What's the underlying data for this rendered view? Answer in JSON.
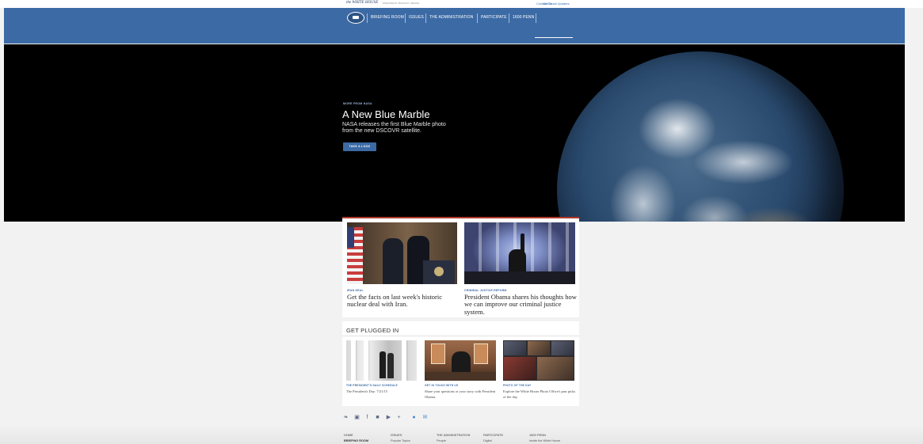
{
  "utility": {
    "brand": "the WHITE HOUSE",
    "brand_sub": "PRESIDENT BARACK OBAMA",
    "contact": "Contact Us",
    "email_updates": "Get Email Updates"
  },
  "nav": {
    "items": [
      "BRIEFING ROOM",
      "ISSUES",
      "THE ADMINISTRATION",
      "PARTICIPATE",
      "1600 PENN"
    ]
  },
  "hero": {
    "eyebrow": "MORE FROM NASA",
    "title": "A New Blue Marble",
    "description": "NASA releases the first Blue Marble photo from the new DSCOVR satellite.",
    "cta": "TAKE A LOOK"
  },
  "features": [
    {
      "eyebrow": "IRAN DEAL",
      "headline": "Get the facts on last week's historic nuclear deal with Iran."
    },
    {
      "eyebrow": "CRIMINAL JUSTICE REFORM",
      "headline": "President Obama shares his thoughts how we can improve our criminal justice system."
    }
  ],
  "plugged": {
    "heading": "GET PLUGGED IN",
    "items": [
      {
        "eyebrow": "THE PRESIDENT'S DAILY SCHEDULE",
        "text": "The President's Day: 7/21/15"
      },
      {
        "eyebrow": "GET IN TOUCH WITH US",
        "text": "Share your questions or your story with President Obama."
      },
      {
        "eyebrow": "PHOTO OF THE DAY",
        "text": "Explore the White House Photo Office's past picks of the day."
      }
    ]
  },
  "social": {
    "icons": [
      "twitter-icon",
      "instagram-icon",
      "facebook-icon",
      "flickr-icon",
      "youtube-icon",
      "google-plus-icon",
      "chat-icon",
      "email-icon"
    ],
    "glyphs": [
      "❧",
      "▣",
      "f",
      "■",
      "▶",
      "+",
      "●",
      "✉"
    ]
  },
  "footer": {
    "columns": [
      {
        "head": "HOME",
        "sub": "BRIEFING ROOM"
      },
      {
        "head": "ISSUES",
        "sub": "Popular Topics"
      },
      {
        "head": "THE ADMINISTRATION",
        "sub": "People"
      },
      {
        "head": "PARTICIPATE",
        "sub": "Digital"
      },
      {
        "head": "1600 PENN",
        "sub": "Inside the White House"
      }
    ]
  },
  "colors": {
    "nav_blue": "#3c6aa5",
    "accent_red": "#b23a2b",
    "link_blue": "#3b6fb6"
  }
}
